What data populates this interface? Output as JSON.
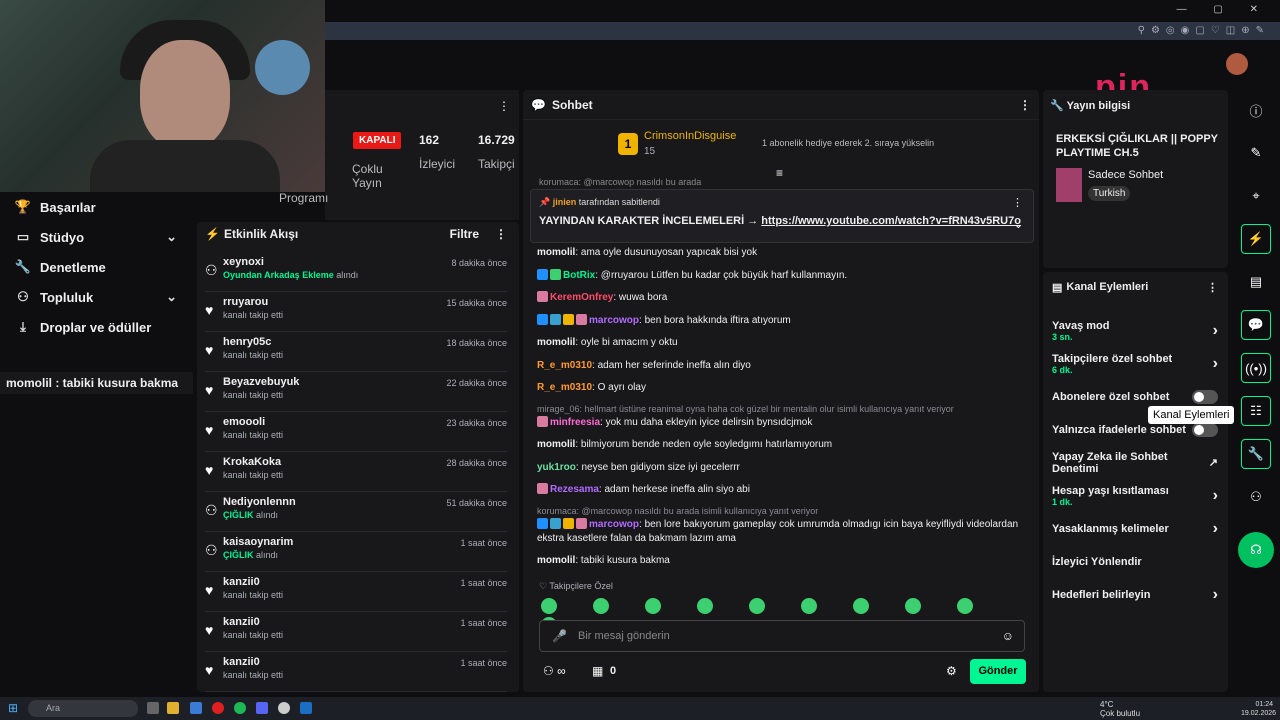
{
  "left_nav": [
    {
      "label": "Başarılar",
      "icon": "trophy-icon",
      "chevron": false
    },
    {
      "label": "Stüdyo",
      "icon": "studio-icon",
      "chevron": true
    },
    {
      "label": "Denetleme",
      "icon": "wrench-icon",
      "chevron": false
    },
    {
      "label": "Topluluk",
      "icon": "community-icon",
      "chevron": true
    },
    {
      "label": "Droplar ve ödüller",
      "icon": "drops-icon",
      "chevron": false
    }
  ],
  "overlay_chat": {
    "user": "momolil",
    "text": " : tabiki kusura bakma"
  },
  "stats": {
    "status": "KAPALI",
    "viewers": "162",
    "viewers_label": "İzleyici",
    "followers": "16.729",
    "followers_label": "Takipçi",
    "multi_label": "Çoklu Yayın",
    "program_label": "Programı"
  },
  "activity": {
    "title": "Etkinlik Akışı",
    "filter": "Filtre",
    "items": [
      {
        "name": "xeynoxi",
        "sub_hl": "Oyundan Arkadaş Ekleme",
        "sub": " alındı",
        "time": "8 dakika önce",
        "icon": "redeem-icon"
      },
      {
        "name": "rruyarou",
        "sub_hl": "",
        "sub": "kanalı takip etti",
        "time": "15 dakika önce",
        "icon": "heart-icon"
      },
      {
        "name": "henry05c",
        "sub_hl": "",
        "sub": "kanalı takip etti",
        "time": "18 dakika önce",
        "icon": "heart-icon"
      },
      {
        "name": "Beyazvebuyuk",
        "sub_hl": "",
        "sub": "kanalı takip etti",
        "time": "22 dakika önce",
        "icon": "heart-icon"
      },
      {
        "name": "emoooli",
        "sub_hl": "",
        "sub": "kanalı takip etti",
        "time": "23 dakika önce",
        "icon": "heart-icon"
      },
      {
        "name": "KrokaKoka",
        "sub_hl": "",
        "sub": "kanalı takip etti",
        "time": "28 dakika önce",
        "icon": "heart-icon"
      },
      {
        "name": "Nediyonlennn",
        "sub_hl": "ÇIĞLIK",
        "sub": " alındı",
        "time": "51 dakika önce",
        "icon": "redeem-icon"
      },
      {
        "name": "kaisaoynarim",
        "sub_hl": "ÇIĞLIK",
        "sub": " alındı",
        "time": "1 saat önce",
        "icon": "redeem-icon"
      },
      {
        "name": "kanzii0",
        "sub_hl": "",
        "sub": "kanalı takip etti",
        "time": "1 saat önce",
        "icon": "heart-icon"
      },
      {
        "name": "kanzii0",
        "sub_hl": "",
        "sub": "kanalı takip etti",
        "time": "1 saat önce",
        "icon": "heart-icon"
      },
      {
        "name": "kanzii0",
        "sub_hl": "",
        "sub": "kanalı takip etti",
        "time": "1 saat önce",
        "icon": "heart-icon"
      }
    ]
  },
  "chat": {
    "title": "Sohbet",
    "gift_user": "CrimsonInDisguise",
    "gift_count": "15",
    "gift_text": "1 abonelik hediye ederek 2. sıraya yükselin",
    "top_cut": "korumaca: @marcowop nasıldı bu arada",
    "pinned_by": "jinien",
    "pinned_label": "tarafından sabitlendi",
    "pinned_text": "YAYINDAN KARAKTER İNCELEMELERİ → ",
    "pinned_link": "https://www.youtube.com/watch?v=fRN43v5RU7o",
    "messages": [
      {
        "reply": "",
        "user": "momolil",
        "color": "#efeff1",
        "badges": [],
        "text": ": ama oyle dusunuyosan yapıcak bisi yok"
      },
      {
        "reply": "",
        "user": "BotRix",
        "color": "#00f593",
        "badges": [
          "#1e90ff",
          "#3cd070"
        ],
        "text": ": @rruyarou Lütfen bu kadar çok büyük harf kullanmayın."
      },
      {
        "reply": "",
        "user": "KeremOnfrey",
        "color": "#ff4a6a",
        "badges": [
          "#d97aa0"
        ],
        "text": ": wuwa bora"
      },
      {
        "reply": "",
        "user": "marcowop",
        "color": "#b36bff",
        "badges": [
          "#1e90ff",
          "#3aa0d0",
          "#f0b400",
          "#d97aa0"
        ],
        "text": ": ben bora hakkında iftira atıyorum"
      },
      {
        "reply": "",
        "user": "momolil",
        "color": "#efeff1",
        "badges": [],
        "text": ": oyle bi amacım y oktu"
      },
      {
        "reply": "",
        "user": "R_e_m0310",
        "color": "#ff9a2a",
        "badges": [],
        "text": ": adam her seferinde ineffa alın diyo"
      },
      {
        "reply": "",
        "user": "R_e_m0310",
        "color": "#ff9a2a",
        "badges": [],
        "text": ": O ayrı olay"
      },
      {
        "reply": "mirage_06: hellmart üstüne reanimal oyna haha cok güzel bir mentalin olur isimli kullanıcıya yanıt veriyor",
        "user": "minfreesia",
        "color": "#ff6ad5",
        "badges": [
          "#d97aa0"
        ],
        "text": ": yok mu daha ekleyin iyice delirsin bynsıdcjmok"
      },
      {
        "reply": "",
        "user": "momolil",
        "color": "#efeff1",
        "badges": [],
        "text": ": bilmiyorum bende neden oyle soyledgımı hatırlamıyorum"
      },
      {
        "reply": "",
        "user": "yuk1roo",
        "color": "#6ae0a0",
        "badges": [],
        "text": ": neyse ben gidiyom size iyi gecelerrr"
      },
      {
        "reply": "",
        "user": "Rezesama",
        "color": "#b36bff",
        "badges": [
          "#d97aa0"
        ],
        "text": ": adam herkese ineffa alin siyo abi"
      },
      {
        "reply": "korumaca: @marcowop nasıldı bu arada isimli kullanıcıya yanıt veriyor",
        "user": "marcowop",
        "color": "#b36bff",
        "badges": [
          "#1e90ff",
          "#3aa0d0",
          "#f0b400",
          "#d97aa0"
        ],
        "text": ": ben lore bakıyorum gameplay cok umrumda olmadıgı icin baya keyifliydi videolardan ekstra kasetlere falan da bakmam lazım ama"
      },
      {
        "reply": "",
        "user": "momolil",
        "color": "#efeff1",
        "badges": [],
        "text": ": tabiki kusura bakma"
      }
    ],
    "followers_only": "Takipçilere Özel",
    "placeholder": "Bir mesaj gönderin",
    "points": "0",
    "send": "Gönder"
  },
  "stream_info": {
    "title": "Yayın bilgisi",
    "stream_title": "ERKEKSİ ÇIĞLIKLAR || POPPY PLAYTIME CH.5",
    "category": "Sadece Sohbet",
    "language": "Turkish"
  },
  "channel_actions": {
    "title": "Kanal Eylemleri",
    "items": [
      {
        "label": "Yavaş mod",
        "sub": "3 sn.",
        "control": "chevron"
      },
      {
        "label": "Takipçilere özel sohbet",
        "sub": "6 dk.",
        "control": "chevron"
      },
      {
        "label": "Abonelere özel sohbet",
        "sub": "",
        "control": "toggle"
      },
      {
        "label": "Yalnızca ifadelerle sohbet",
        "sub": "",
        "control": "toggle"
      },
      {
        "label": "Yapay Zeka ile Sohbet Denetimi",
        "sub": "",
        "control": "external"
      },
      {
        "label": "Hesap yaşı kısıtlaması",
        "sub": "1 dk.",
        "control": "chevron"
      },
      {
        "label": "Yasaklanmış kelimeler",
        "sub": "",
        "control": "chevron"
      },
      {
        "label": "İzleyici Yönlendir",
        "sub": "",
        "control": ""
      },
      {
        "label": "Hedefleri belirleyin",
        "sub": "",
        "control": "chevron"
      }
    ]
  },
  "tooltip": "Kanal Eylemleri",
  "overlay_logo": "pin",
  "taskbar": {
    "search": "Ara",
    "weather_temp": "4°C",
    "weather_desc": "Çok bulutlu",
    "time": "01:24",
    "date": "19.02.2026"
  }
}
